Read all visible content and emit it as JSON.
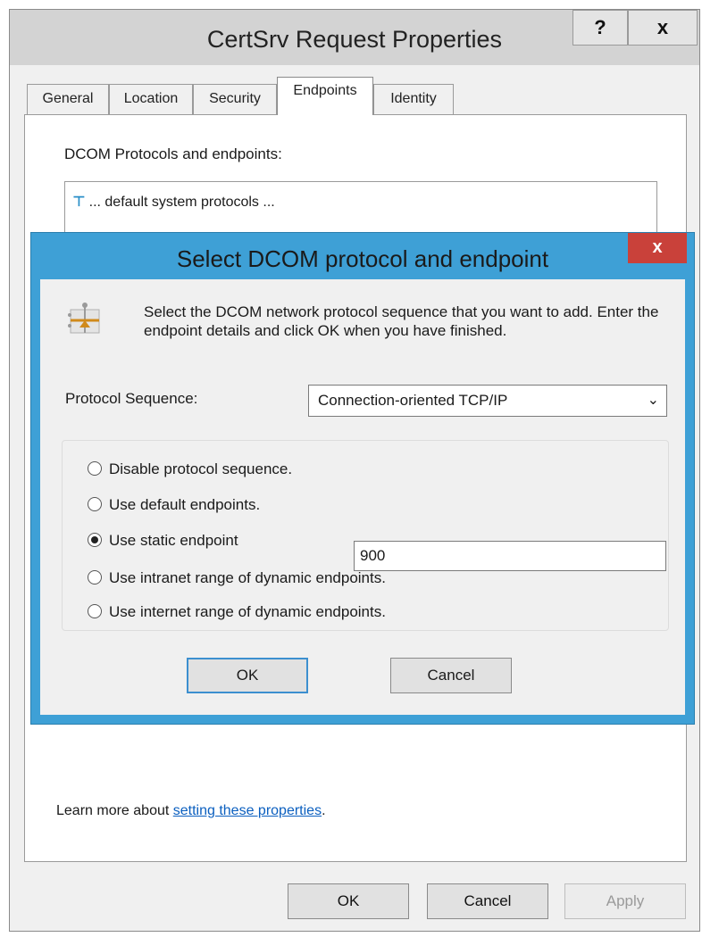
{
  "outer": {
    "title": "CertSrv Request Properties",
    "help_label": "?",
    "close_label": "x",
    "tabs": [
      "General",
      "Location",
      "Security",
      "Endpoints",
      "Identity"
    ],
    "active_tab": "Endpoints",
    "dcom_label": "DCOM Protocols and endpoints:",
    "list_item": "... default system protocols ...",
    "learn_prefix": "Learn more about ",
    "learn_link": "setting these properties",
    "learn_suffix": ".",
    "ok_label": "OK",
    "cancel_label": "Cancel",
    "apply_label": "Apply"
  },
  "dialog": {
    "title": "Select DCOM protocol and endpoint",
    "close_label": "x",
    "description": "Select the DCOM network protocol sequence that you want to add. Enter the endpoint details and click OK when you have finished.",
    "protocol_label": "Protocol Sequence:",
    "protocol_value": "Connection-oriented TCP/IP",
    "options": [
      "Disable protocol sequence.",
      "Use default endpoints.",
      "Use static endpoint",
      "Use intranet range of dynamic endpoints.",
      "Use internet range of dynamic endpoints."
    ],
    "selected_option": "Use static endpoint",
    "static_endpoint_value": "900",
    "ok_label": "OK",
    "cancel_label": "Cancel"
  },
  "colors": {
    "dialog_frame": "#3ea0d6",
    "dialog_close": "#c9413a",
    "link": "#0b5fbf"
  }
}
